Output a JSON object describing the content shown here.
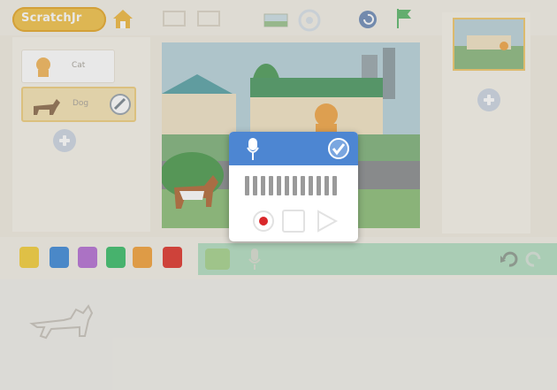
{
  "app": {
    "logo_text": "ScratchJr"
  },
  "sprites": {
    "items": [
      {
        "label": "Cat",
        "selected": false
      },
      {
        "label": "Dog",
        "selected": true
      }
    ]
  },
  "dialog": {
    "title_icon": "microphone-icon",
    "meter_level": 12,
    "controls": [
      "record-icon",
      "stop-icon",
      "play-icon"
    ],
    "confirm_icon": "checkmark-icon"
  },
  "palette": {
    "categories": [
      "triggering-blocks",
      "motion-blocks",
      "looks-blocks",
      "sound-blocks",
      "control-blocks",
      "end-blocks"
    ],
    "category_colors": [
      "#f4cf3a",
      "#3f8ad8",
      "#b56fd3",
      "#3bbd6a",
      "#f3a23a",
      "#e0352b"
    ]
  },
  "colors": {
    "accent": "#4d86d2",
    "record": "#d9282b"
  }
}
